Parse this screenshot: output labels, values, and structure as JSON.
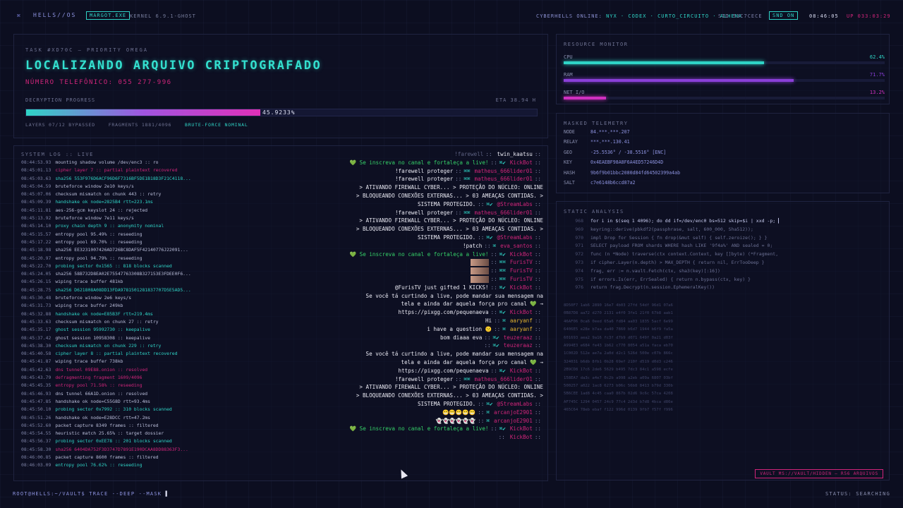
{
  "topbar": {
    "logo": "⌘",
    "brand": "HELLS//OS",
    "process": "MARGOT.EXE",
    "kernel": "KERNEL 6.9.1-GHOST",
    "online_label": "CYBERHELLS ONLINE:",
    "online_users": "NYX · CODEX · CURTO_CIRCUITO · ALHENA",
    "sid": "SID 53C7CECE",
    "snd": "SND ON",
    "clock": "08:46:05",
    "uptime": "UP 033:03:29"
  },
  "task": {
    "label": "TASK #XD70C — PRIORITY OMEGA",
    "title": "LOCALIZANDO ARQUIVO CRIPTOGRAFADO",
    "phone": "NÚMERO TELEFÔNICO: 055 277-996",
    "progress_label": "DECRYPTION PROGRESS",
    "eta": "ETA 38.94 H",
    "progress_text": "45.9233%",
    "progress": 0.459,
    "meta": {
      "layers": "LAYERS 07/12 BYPASSED",
      "fragments": "FRAGMENTS 1881/4096",
      "status": "BRUTE-FORCE NOMINAL"
    }
  },
  "syslog": {
    "title": "SYSTEM LOG :: LIVE",
    "lines": [
      {
        "t": "08:44:53.93",
        "m": "mounting shadow volume /dev/enc3 :: ro",
        "c": "def"
      },
      {
        "t": "08:45:01.13",
        "m": "cipher layer 7 :: partial plaintext recovered",
        "c": "pink"
      },
      {
        "t": "08:45:03.63",
        "m": "sha256 553F976D6ACF96D6F7316BF5DE1B18D3F21C4118...",
        "c": "teal"
      },
      {
        "t": "08:45:04.59",
        "m": "bruteforce window 2e10 keys/s",
        "c": "def"
      },
      {
        "t": "08:45:07.06",
        "m": "checksum mismatch on chunk 443 :: retry",
        "c": "def"
      },
      {
        "t": "08:45:09.39",
        "m": "handshake ok node=2825B4 rtt=223.1ms",
        "c": "teal"
      },
      {
        "t": "08:45:11.81",
        "m": "aes-256-gcm keyslot 24 :: rejected",
        "c": "def"
      },
      {
        "t": "08:45:13.92",
        "m": "bruteforce window 7e11 keys/s",
        "c": "def"
      },
      {
        "t": "08:45:14.10",
        "m": "proxy chain depth 9 :: anonymity nominal",
        "c": "teal"
      },
      {
        "t": "08:45:15.57",
        "m": "entropy pool 95.49% :: reseeding",
        "c": "def"
      },
      {
        "t": "08:45:17.22",
        "m": "entropy pool 69.70% :: reseeding",
        "c": "def"
      },
      {
        "t": "08:45:18.98",
        "m": "sha256 EE3231007426AD726BC8DAF5F42140776J22091...",
        "c": "def"
      },
      {
        "t": "08:45:20.97",
        "m": "entropy pool 94.79% :: reseeding",
        "c": "def"
      },
      {
        "t": "08:45:22.70",
        "m": "probing sector 0x1565 :: 818 blocks scanned",
        "c": "teal"
      },
      {
        "t": "08:45:24.05",
        "m": "sha256 58B732D8EA02E75547763308B327153E3FDEE0F6...",
        "c": "def"
      },
      {
        "t": "08:45:26.15",
        "m": "wiping trace buffer 481kb",
        "c": "def"
      },
      {
        "t": "08:45:28.75",
        "m": "sha256 D621808A08DD13FDA9781501281837707D5E5AD5...",
        "c": "teal"
      },
      {
        "t": "08:45:30.48",
        "m": "bruteforce window 2e6 keys/s",
        "c": "def"
      },
      {
        "t": "08:45:31.73",
        "m": "wiping trace buffer 249kb",
        "c": "def"
      },
      {
        "t": "08:45:32.88",
        "m": "handshake ok node=E85B3F rtt=219.4ms",
        "c": "teal"
      },
      {
        "t": "08:45:33.63",
        "m": "checksum mismatch on chunk 27 :: retry",
        "c": "def"
      },
      {
        "t": "08:45:35.17",
        "m": "ghost session 95992730 :: keepalive",
        "c": "teal"
      },
      {
        "t": "08:45:37.42",
        "m": "ghost session 10958308 :: keepalive",
        "c": "def"
      },
      {
        "t": "08:45:38.30",
        "m": "checksum mismatch on chunk 229 :: retry",
        "c": "teal"
      },
      {
        "t": "08:45:40.58",
        "m": "cipher layer 8 :: partial plaintext recovered",
        "c": "teal"
      },
      {
        "t": "08:45:41.87",
        "m": "wiping trace buffer 738kb",
        "c": "def"
      },
      {
        "t": "08:45:42.63",
        "m": "dns tunnel 09E88.onion :: resolved",
        "c": "pink"
      },
      {
        "t": "08:45:43.79",
        "m": "defragmenting fragment 1609/4096",
        "c": "pink"
      },
      {
        "t": "08:45:45.35",
        "m": "entropy pool 71.58% :: reseeding",
        "c": "pink"
      },
      {
        "t": "08:45:46.93",
        "m": "dns tunnel 66A1D.onion :: resolved",
        "c": "def"
      },
      {
        "t": "08:45:47.85",
        "m": "handshake ok node=C55G8D rtt=93.4ms",
        "c": "def"
      },
      {
        "t": "08:45:50.10",
        "m": "probing sector 0x7992 :: 310 blocks scanned",
        "c": "teal"
      },
      {
        "t": "08:45:51.26",
        "m": "handshake ok node=E28DCC rtt=47.2ms",
        "c": "def"
      },
      {
        "t": "08:45:52.60",
        "m": "packet capture 8349 frames :: filtered",
        "c": "def"
      },
      {
        "t": "08:45:54.55",
        "m": "heuristic match 25.65% :: target dossier",
        "c": "def"
      },
      {
        "t": "08:45:56.37",
        "m": "probing sector 0xEE78 :: 201 blocks scanned",
        "c": "teal"
      },
      {
        "t": "08:45:58.30",
        "m": "sha256 6404DA752F3D3747D7891E190DCAA8DD88363F3...",
        "c": "pink"
      },
      {
        "t": "08:46:00.85",
        "m": "packet capture 8600 frames :: filtered",
        "c": "def"
      },
      {
        "t": "08:46:03.09",
        "m": "entropy pool 76.62% :: reseeding",
        "c": "teal"
      }
    ]
  },
  "chat": [
    {
      "m": "!farewell",
      "u": "twin_kaatsu",
      "ghost": true,
      "uc": "gold"
    },
    {
      "m": "💚 Se inscreva no canal e fortaleça a live!",
      "u": "KickBot",
      "uc": "pink",
      "icons": "⌘✔",
      "green": true
    },
    {
      "m": "!farewell proteger",
      "u": "matheus_666lider01",
      "uc": "pink",
      "icons": "⌘⌘"
    },
    {
      "m": "!farewell proteger",
      "u": "matheus_666lider01",
      "uc": "pink",
      "icons": "⌘⌘"
    },
    {
      "m": "> ATIVANDO FIREWALL CYBER... > PROTEÇÃO DO NÚCLEO: ONLINE",
      "u": "",
      "uc": "white"
    },
    {
      "m": "> BLOQUEANDO CONEXÕES EXTERNAS... > 03 AMEAÇAS CONTIDAS. >",
      "u": "",
      "uc": "white"
    },
    {
      "m": "SISTEMA PROTEGIDO.",
      "u": "@StreamLabs",
      "uc": "pink",
      "icons": "⌘✔"
    },
    {
      "m": "!farewell proteger",
      "u": "matheus_666lider01",
      "uc": "pink",
      "icons": "⌘⌘"
    },
    {
      "m": "> ATIVANDO FIREWALL CYBER... > PROTEÇÃO DO NÚCLEO: ONLINE",
      "u": "",
      "uc": "white"
    },
    {
      "m": "> BLOQUEANDO CONEXÕES EXTERNAS... > 03 AMEAÇAS CONTIDAS. >",
      "u": "",
      "uc": "white"
    },
    {
      "m": "SISTEMA PROTEGIDO.",
      "u": "@StreamLabs",
      "uc": "pink",
      "icons": "⌘✔"
    },
    {
      "m": "!patch",
      "u": "eva_santos",
      "uc": "pink",
      "icons": "⌘"
    },
    {
      "m": "💚 Se inscreva no canal e fortaleça a live!",
      "u": "KickBot",
      "uc": "pink",
      "icons": "⌘✔",
      "green": true
    },
    {
      "m": "",
      "u": "FurisTV",
      "uc": "pink",
      "icons": "⌘⌘",
      "pic": true
    },
    {
      "m": "",
      "u": "FurisTV",
      "uc": "pink",
      "icons": "⌘⌘",
      "pic": true
    },
    {
      "m": "",
      "u": "FurisTV",
      "uc": "pink",
      "icons": "⌘⌘",
      "pic": true
    },
    {
      "m": "@FurisTV just gifted 1 KICKS!",
      "u": "KickBot",
      "uc": "pink",
      "icons": "⌘✔"
    },
    {
      "m": "Se você tá curtindo a live, pode mandar sua mensagem na",
      "u": "",
      "uc": "white"
    },
    {
      "m": "tela e ainda dar aquela força pro canal 💚 →",
      "u": "",
      "uc": "white"
    },
    {
      "m": "https://pixgg.com/pequenaeva",
      "u": "KickBot",
      "uc": "pink",
      "icons": "⌘✔"
    },
    {
      "m": "Hi",
      "u": "aaryanf",
      "uc": "gold",
      "icons": "⌘"
    },
    {
      "m": "i have a question 😕",
      "u": "aaryanf",
      "uc": "gold",
      "icons": "⌘"
    },
    {
      "m": "bom diaaa eva",
      "u": "teuzeraaz",
      "uc": "pink",
      "icons": "⌘✔"
    },
    {
      "m": "",
      "u": "teuzeraaz",
      "uc": "pink",
      "icons": "⌘✔"
    },
    {
      "m": "Se você tá curtindo a live, pode mandar sua mensagem na",
      "u": "",
      "uc": "white"
    },
    {
      "m": "tela e ainda dar aquela força pro canal 💚 →",
      "u": "",
      "uc": "white"
    },
    {
      "m": "https://pixgg.com/pequenaeva",
      "u": "KickBot",
      "uc": "pink",
      "icons": "⌘✔"
    },
    {
      "m": "!farewell proteger",
      "u": "matheus_666lider01",
      "uc": "pink",
      "icons": "⌘⌘"
    },
    {
      "m": "> ATIVANDO FIREWALL CYBER... > PROTEÇÃO DO NÚCLEO: ONLINE",
      "u": "",
      "uc": "white"
    },
    {
      "m": "> BLOQUEANDO CONEXÕES EXTERNAS... > 03 AMEAÇAS CONTIDAS. >",
      "u": "",
      "uc": "white"
    },
    {
      "m": "SISTEMA PROTEGIDO.",
      "u": "@StreamLabs",
      "uc": "pink",
      "icons": "⌘✔"
    },
    {
      "m": "😁😁😁😁😁",
      "u": "arcanjoE2901",
      "uc": "pink",
      "icons": "⌘"
    },
    {
      "m": "👻👻👻👻👻👻",
      "u": "arcanjoE2901",
      "uc": "pink",
      "icons": "⌘"
    },
    {
      "m": "💚 Se inscreva no canal e fortaleça a live!",
      "u": "KickBot",
      "uc": "pink",
      "icons": "⌘✔",
      "green": true
    },
    {
      "m": "",
      "u": "KickBot",
      "uc": "pink",
      "icons": ""
    }
  ],
  "resources": {
    "title": "RESOURCE MONITOR",
    "items": [
      {
        "name": "CPU",
        "value": "62.4%",
        "frac": 0.624,
        "color": "#2fd4c6"
      },
      {
        "name": "RAM",
        "value": "71.7%",
        "frac": 0.717,
        "color": "#8a3fd8"
      },
      {
        "name": "NET I/O",
        "value": "13.2%",
        "frac": 0.132,
        "color": "#d030c0"
      }
    ]
  },
  "telemetry": {
    "title": "MASKED TELEMETRY",
    "items": [
      {
        "k": "NODE",
        "v": "84.***.***.207"
      },
      {
        "k": "RELAY",
        "v": "***.***.130.41"
      },
      {
        "k": "GEO",
        "v": "-25.5536° / -38.5516° [ENC]"
      },
      {
        "k": "KEY",
        "v": "0x4EAEBF98A8F6A4ED57246D4D"
      },
      {
        "k": "HASH",
        "v": "9b6f9b01bbc2080d84fd64502399a4ab"
      },
      {
        "k": "SALT",
        "v": "c7e6148b6ccd87a2"
      }
    ]
  },
  "static": {
    "title": "STATIC ANALYSIS",
    "code": [
      {
        "n": "968",
        "t": "for i in $(seq 1 4096); do dd if=/dev/enc0 bs=512 skip=$i | xxd -p; ▌",
        "cur": true
      },
      {
        "n": "969",
        "t": "keyring::derive(pbkdf2(passphrase, salt, 600_000, Sha512));"
      },
      {
        "n": "970",
        "t": "impl Drop for Session { fn drop(&mut self) { self.zeroize(); } }"
      },
      {
        "n": "971",
        "t": "SELECT payload FROM shards WHERE hash LIKE '9f4a%' AND sealed = 0;"
      },
      {
        "n": "972",
        "t": "func (n *Node) traverse(ctx context.Context, key []byte) (*Fragment, error) {"
      },
      {
        "n": "973",
        "t": "if cipher.Layer(n.depth) > MAX_DEPTH { return nil, ErrTooDeep }"
      },
      {
        "n": "974",
        "t": "frag, err := n.vault.Fetch(ctx, sha3(key)[:16])"
      },
      {
        "n": "975",
        "t": "if errors.Is(err, ErrSealed) { return n.bypass(ctx, key) }"
      },
      {
        "n": "976",
        "t": "return frag.Decrypt(n.session.EphemeralKey())"
      }
    ],
    "hex": [
      "8D50F7 1ab6 2890 16e7 4b03 27fd 54df 96d1 07a6",
      "0B87D8 aa72 d270 2131 e4f0 3fe1 21f0 67b8 aab1",
      "46AF06 0ca6 0eed 65a6 fd84 aa03 1835 5acf 6e99",
      "6406E5 e28e b7aa da40 7860 b6d7 1944 b6f9 fa5a",
      "601693 aea2 9a16 fc3f d7b9 d071 649f 0a21 d03f",
      "A994E3 e684 fe43 1b62 c770 8054 a51a faca eb70",
      "1C002D 512e ae7a 2a0d d2c1 526d 500e c07b 866c",
      "324031 b6db 8fb1 0b28 69ef 210f d519 d0d3 c246",
      "2B9CD8 17c6 2de6 5629 b495 7dc3 84c1 a598 ecfe",
      "158EA7 da3c a4e7 0c2b a998 a2eb a09a 6807 03bf",
      "500257 a022 1ac8 6273 b06c 56b8 8413 b79d 330b",
      "5B6CEE 1ad8 4c45 caa0 867b 02d6 9c6c 57ca 4208",
      "AF745C 1294 0457 24c9 77c4 2d3d b7d8 4bca d86e",
      "465C64 78eb ebaf f122 996d 0139 9fb7 f57f f996"
    ],
    "vault": "VAULT MS://VAULT/HIDDEN — R56 ARQUIVOS"
  },
  "bottom": {
    "prompt": "ROOT@HELLS:~/VAULT$ TRACE --DEEP --MASK",
    "cursor": "▌",
    "status": "STATUS: SEARCHING"
  }
}
